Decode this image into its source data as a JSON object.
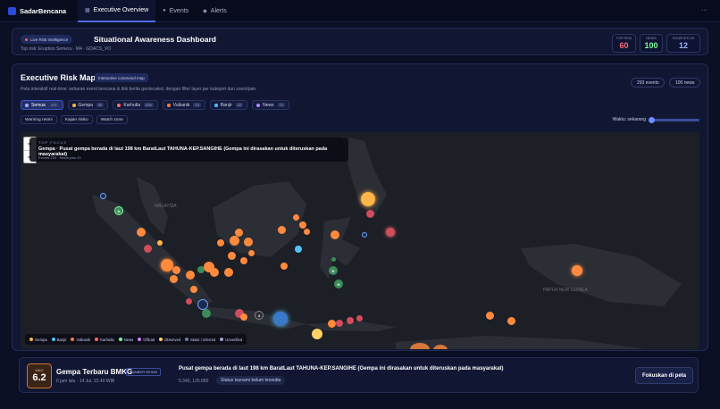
{
  "nav": {
    "brand": "SadarBencana",
    "tabs": [
      {
        "label": "Executive Overview",
        "icon": "grid-icon"
      },
      {
        "label": "Events",
        "icon": "dot-icon"
      },
      {
        "label": "Alerts",
        "icon": "diamond-icon"
      }
    ],
    "more": "···"
  },
  "header": {
    "live_badge": "Live Risk Intelligence",
    "title": "Situational Awareness Dashboard",
    "subtitle": "Top risk: Eruption Semeru · M4 · GDACS_VO",
    "stats": [
      {
        "label": "TOP RISK",
        "value": "60",
        "color": "#ff6b7a"
      },
      {
        "label": "NEWS",
        "value": "100",
        "color": "#7dff9a"
      },
      {
        "label": "SOURCES OK",
        "value": "12",
        "color": "#9fb2ff"
      }
    ]
  },
  "main": {
    "title": "Executive Risk Map",
    "pill": "Interactive command map",
    "description": "Peta interaktif real-time: sebaran event bencana & titik berita geolocated, dengan filter layer per kategori dan zoom/pan.",
    "events_count": "293 events",
    "news_count": "100 news",
    "filters": [
      {
        "label": "Semua",
        "count": "293",
        "color": "#9fb2ff"
      },
      {
        "label": "Gempa",
        "count": "52",
        "color": "#ffb547"
      },
      {
        "label": "Karhutla",
        "count": "205",
        "color": "#ff6b6b"
      },
      {
        "label": "Vulkanik",
        "count": "13",
        "color": "#ff7b3d"
      },
      {
        "label": "Banjir",
        "count": "22",
        "color": "#4fc3ff"
      },
      {
        "label": "News",
        "count": "71",
        "color": "#b18cff"
      }
    ],
    "toggles": [
      "Warning resmi",
      "Kajian risiko",
      "Watch zone"
    ],
    "time_label": "Waktu: sekarang",
    "time_position": 0.0
  },
  "map": {
    "zoom_in": "+",
    "zoom_out": "−",
    "top_focus_label": "TOP FOCUS",
    "top_focus_title": "Gempa · Pusat gempa berada di laut 198 km BaratLaut TAHUNA-KEP.SANGIHE (Gempa ini dirasakan untuk diteruskan pada masyarakat)",
    "top_focus_meta": "Events 220 · News pins 20",
    "region_labels": [
      "MALAYSIA",
      "PAPUA NEW GUINEA"
    ],
    "legend": [
      {
        "label": "Gempa",
        "color": "#ffb547"
      },
      {
        "label": "Banjir",
        "color": "#4fc3ff"
      },
      {
        "label": "Vulkanik",
        "color": "#ff7b3d"
      },
      {
        "label": "Karhutla",
        "color": "#ff6b6b"
      },
      {
        "label": "News",
        "color": "#7dff9a"
      },
      {
        "label": "Official",
        "color": "#d27cff"
      },
      {
        "label": "Observed",
        "color": "#ffd166"
      },
      {
        "label": "Static / inferred",
        "color": "#6c7aa8"
      },
      {
        "label": "Unverified",
        "color": "#9aa3c8"
      }
    ]
  },
  "bottom": {
    "mag_label": "MAG",
    "mag_value": "6.2",
    "title": "Gempa Terbaru BMKG",
    "source": "SUMBER RESMI",
    "meta": "6 jam lalu · 14 Jul, 22.49 WIB",
    "event_title": "Pusat gempa berada di laut 198 km BaratLaut TAHUNA-KEP.SANGIHE (Gempa ini dirasakan untuk diteruskan pada masyarakat)",
    "coords": "5.340, 125.060",
    "tsunami": "Status tsunami belum tersedia",
    "focus_button": "Fokuskan di peta"
  }
}
